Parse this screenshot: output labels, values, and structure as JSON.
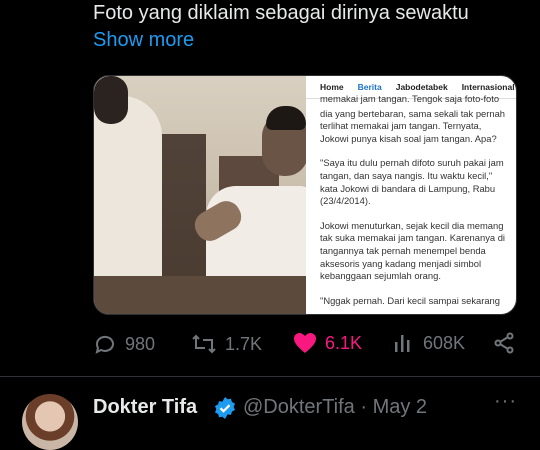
{
  "tweet": {
    "text": "Foto yang diklaim sebagai dirinya  sewaktu",
    "show_more": "Show more"
  },
  "article": {
    "nav": [
      "Home",
      "Berita",
      "Jabodetabek",
      "Internasional"
    ],
    "active_nav": "Berita",
    "top_fragment": "memakai jam tangan. Tengok saja foto-foto",
    "para1": "dia yang bertebaran, sama sekali tak pernah terlihat memakai jam tangan. Ternyata, Jokowi punya kisah soal jam tangan. Apa?",
    "para2": "\"Saya itu dulu pernah difoto suruh pakai jam tangan, dan saya nangis. Itu waktu kecil,\" kata Jokowi di bandara di Lampung, Rabu (23/4/2014).",
    "para3": "Jokowi menuturkan, sejak kecil dia memang tak suka memakai jam tangan. Karenanya di tangannya tak pernah menempel benda aksesoris yang kadang menjadi simbol kebanggaan sejumlah orang.",
    "para4": "\"Nggak pernah. Dari kecil sampai sekarang"
  },
  "actions": {
    "replies": "980",
    "reposts": "1.7K",
    "likes": "6.1K",
    "views": "608K"
  },
  "colors": {
    "accent": "#1d9bf0",
    "like": "#f91880",
    "muted": "#71767b"
  },
  "next_post": {
    "name": "Dokter Tifa",
    "handle_date": "@DokterTifa · May 2",
    "more_label": "···"
  }
}
